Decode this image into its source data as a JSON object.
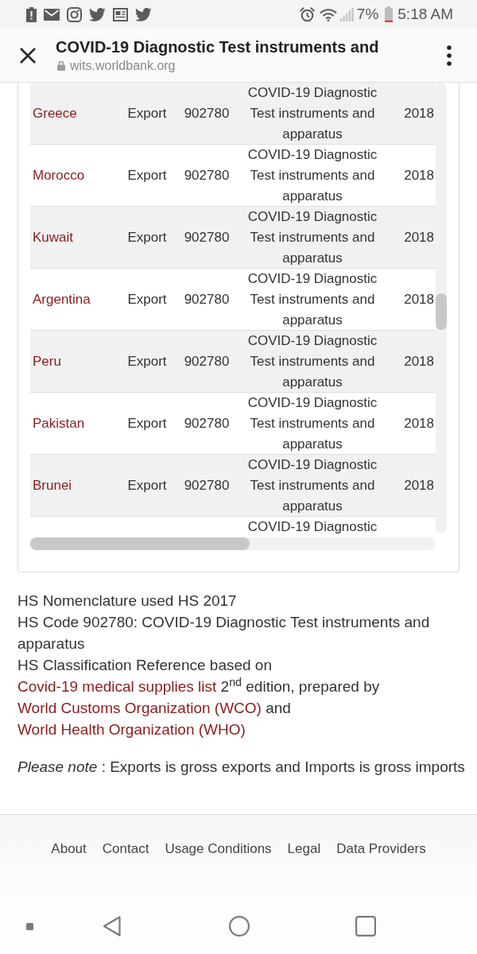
{
  "status_bar": {
    "battery_percent": "7%",
    "time": "5:18 AM"
  },
  "toolbar": {
    "title": "COVID-19 Diagnostic Test instruments and",
    "url": "wits.worldbank.org"
  },
  "table": {
    "rows": [
      {
        "column_1": "Greece",
        "column_2": "Export",
        "column_3": "902780",
        "column_4": "COVID-19 Diagnostic Test instruments and apparatus",
        "column_5": "2018"
      },
      {
        "column_1": "Morocco",
        "column_2": "Export",
        "column_3": "902780",
        "column_4": "COVID-19 Diagnostic Test instruments and apparatus",
        "column_5": "2018"
      },
      {
        "column_1": "Kuwait",
        "column_2": "Export",
        "column_3": "902780",
        "column_4": "COVID-19 Diagnostic Test instruments and apparatus",
        "column_5": "2018"
      },
      {
        "column_1": "Argentina",
        "column_2": "Export",
        "column_3": "902780",
        "column_4": "COVID-19 Diagnostic Test instruments and apparatus",
        "column_5": "2018"
      },
      {
        "column_1": "Peru",
        "column_2": "Export",
        "column_3": "902780",
        "column_4": "COVID-19 Diagnostic Test instruments and apparatus",
        "column_5": "2018"
      },
      {
        "column_1": "Pakistan",
        "column_2": "Export",
        "column_3": "902780",
        "column_4": "COVID-19 Diagnostic Test instruments and apparatus",
        "column_5": "2018"
      },
      {
        "column_1": "Brunei",
        "column_2": "Export",
        "column_3": "902780",
        "column_4": "COVID-19 Diagnostic Test instruments and apparatus",
        "column_5": "2018"
      },
      {
        "column_4": "COVID-19 Diagnostic"
      }
    ]
  },
  "notes": [
    {
      "kind": "plain",
      "text": "HS Nomenclature used HS 2017"
    },
    {
      "kind": "plain",
      "text": "HS Code 902780: COVID-19 Diagnostic Test instruments and apparatus"
    },
    {
      "kind": "linked",
      "parts": [
        {
          "kind": "text",
          "text": "HS Classification Reference based on "
        },
        {
          "kind": "link",
          "text": "Covid-19 medical supplies list"
        },
        {
          "kind": "text",
          "text": " 2$^{nd}$ edition, prepared by "
        },
        {
          "kind": "link",
          "text": "World Customs Organization (WCO)"
        },
        {
          "kind": "text",
          "text": " and "
        },
        {
          "kind": "link",
          "text": "World Health Organization (WHO)"
        }
      ]
    }
  ],
  "please_note": "*Please note* : Exports is gross exports and Imports is gross imports",
  "footer_links": [
    "About",
    "Contact",
    "Usage Conditions",
    "Legal",
    "Data Providers"
  ]
}
